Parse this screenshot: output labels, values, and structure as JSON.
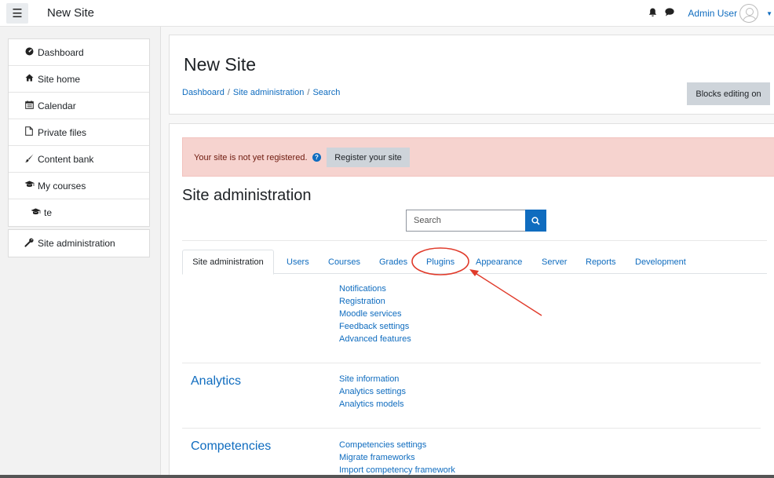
{
  "navbar": {
    "menu_icon": "hamburger-icon",
    "site_name": "New Site",
    "notification_icon": "bell-icon",
    "messages_icon": "chat-icon",
    "user_name": "Admin User",
    "avatar_icon": "user-avatar-icon"
  },
  "drawer": {
    "items": [
      {
        "label": "Dashboard",
        "icon": "dashboard-icon"
      },
      {
        "label": "Site home",
        "icon": "home-icon"
      },
      {
        "label": "Calendar",
        "icon": "calendar-icon"
      },
      {
        "label": "Private files",
        "icon": "file-icon"
      },
      {
        "label": "Content bank",
        "icon": "brush-icon"
      },
      {
        "label": "My courses",
        "icon": "graduation-cap-icon"
      },
      {
        "label": "te",
        "icon": "graduation-cap-icon"
      }
    ],
    "admin_item": {
      "label": "Site administration",
      "icon": "wrench-icon"
    }
  },
  "header": {
    "title": "New Site",
    "breadcrumb": [
      "Dashboard",
      "Site administration",
      "Search"
    ],
    "breadcrumb_separator": "/",
    "blocks_editing_label": "Blocks editing on"
  },
  "alert": {
    "text": "Your site is not yet registered.",
    "help_icon": "question-circle-icon",
    "button_label": "Register your site"
  },
  "admin": {
    "title": "Site administration",
    "search_placeholder": "Search",
    "search_icon": "search-icon",
    "tabs": [
      "Site administration",
      "Users",
      "Courses",
      "Grades",
      "Plugins",
      "Appearance",
      "Server",
      "Reports",
      "Development"
    ],
    "active_tab": "Site administration",
    "general_links": [
      "Notifications",
      "Registration",
      "Moodle services",
      "Feedback settings",
      "Advanced features"
    ],
    "sections": [
      {
        "name": "Analytics",
        "links": [
          "Site information",
          "Analytics settings",
          "Analytics models"
        ]
      },
      {
        "name": "Competencies",
        "links": [
          "Competencies settings",
          "Migrate frameworks",
          "Import competency framework"
        ]
      }
    ]
  },
  "colors": {
    "link": "#0f6cbf",
    "alert_bg": "#f6d3cf",
    "button_bg": "#ced4da",
    "annotation": "#e03a2a"
  }
}
